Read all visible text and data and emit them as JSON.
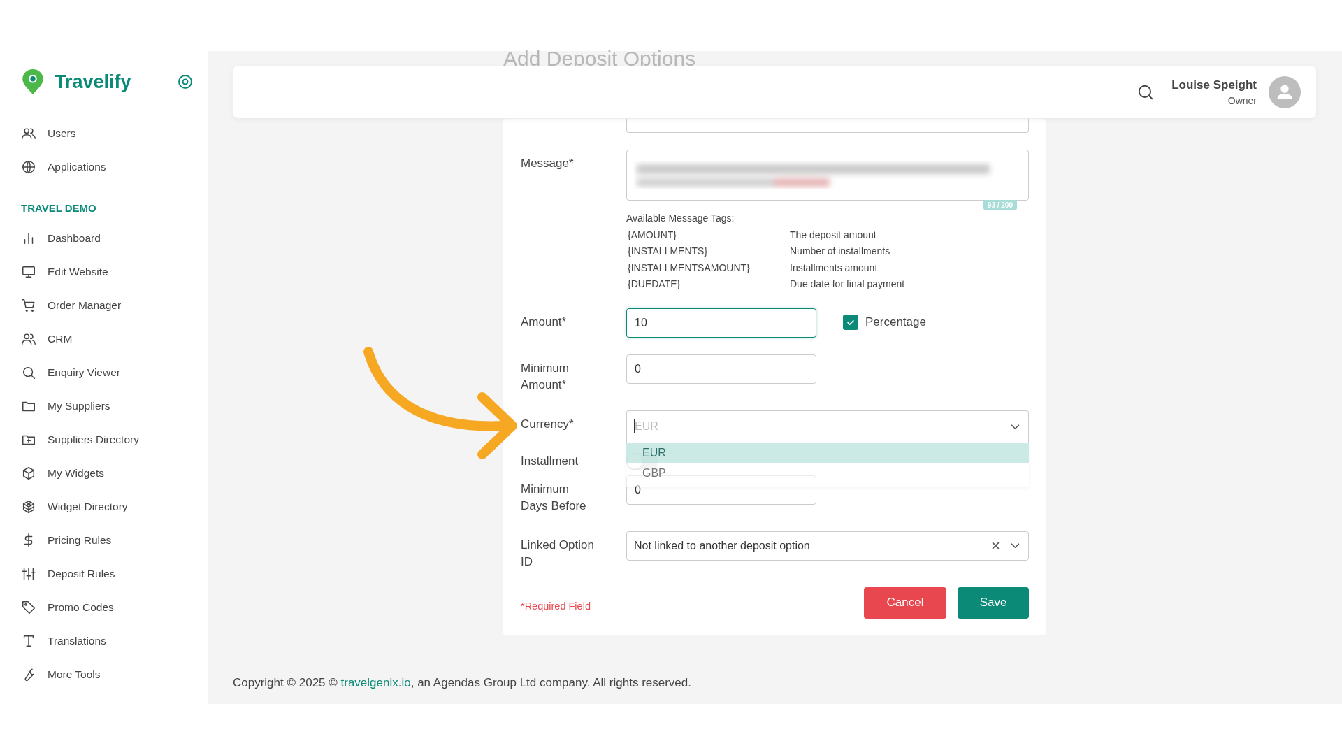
{
  "brand": {
    "name": "Travelify"
  },
  "sidebar": {
    "top_items": [
      {
        "label": "Users"
      },
      {
        "label": "Applications"
      }
    ],
    "section": {
      "title": "TRAVEL DEMO",
      "items": [
        {
          "label": "Dashboard"
        },
        {
          "label": "Edit Website"
        },
        {
          "label": "Order Manager"
        },
        {
          "label": "CRM"
        },
        {
          "label": "Enquiry Viewer"
        },
        {
          "label": "My Suppliers"
        },
        {
          "label": "Suppliers Directory"
        },
        {
          "label": "My Widgets"
        },
        {
          "label": "Widget Directory"
        },
        {
          "label": "Pricing Rules"
        },
        {
          "label": "Deposit Rules"
        },
        {
          "label": "Promo Codes"
        },
        {
          "label": "Translations"
        },
        {
          "label": "More Tools"
        }
      ]
    }
  },
  "header": {
    "user_name": "Louise Speight",
    "user_role": "Owner"
  },
  "page_title": "Add Deposit Options",
  "form": {
    "message": {
      "label": "Message*",
      "counter": "93 / 200"
    },
    "tags": {
      "heading": "Available Message Tags:",
      "rows": [
        {
          "tag": "{AMOUNT}",
          "description": "The deposit amount"
        },
        {
          "tag": "{INSTALLMENTS}",
          "description": "Number of installments"
        },
        {
          "tag": "{INSTALLMENTSAMOUNT}",
          "description": "Installments amount"
        },
        {
          "tag": "{DUEDATE}",
          "description": "Due date for final payment"
        }
      ]
    },
    "amount": {
      "label": "Amount*",
      "value": "10",
      "focused": true
    },
    "percentage": {
      "label": "Percentage",
      "checked": true
    },
    "minimum_amount": {
      "label": "Minimum Amount*",
      "value": "0"
    },
    "currency": {
      "label": "Currency*",
      "placeholder": "EUR",
      "expanded": true,
      "options": [
        {
          "label": "EUR",
          "selected": true
        },
        {
          "label": "GBP",
          "selected": false
        }
      ]
    },
    "installment": {
      "label": "Installment",
      "on": false
    },
    "minimum_days": {
      "label": "Minimum Days Before",
      "value": "0"
    },
    "linked_option": {
      "label": "Linked Option ID",
      "value": "Not linked to another deposit option"
    },
    "required_note": "*Required Field",
    "buttons": {
      "cancel": "Cancel",
      "save": "Save"
    }
  },
  "footer": {
    "before": "Copyright © 2025 © ",
    "link": "travelgenix.io",
    "after": ", an Agendas Group Ltd company. All rights reserved."
  }
}
